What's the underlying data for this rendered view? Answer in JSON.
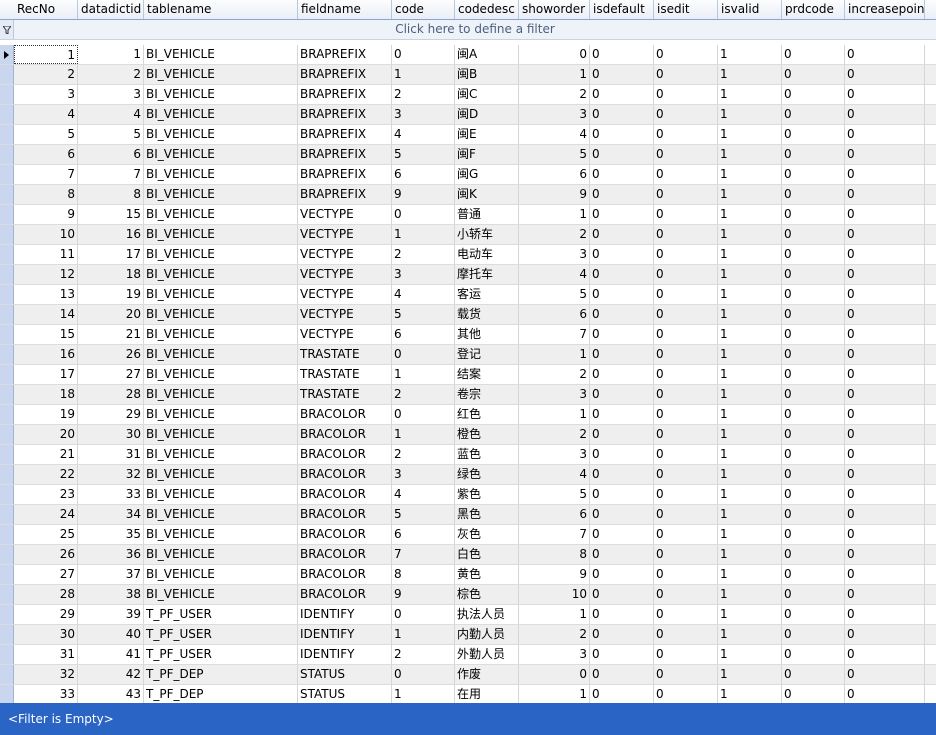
{
  "columns": [
    "RecNo",
    "datadictid",
    "tablename",
    "fieldname",
    "code",
    "codedesc",
    "showorder",
    "isdefault",
    "isedit",
    "isvalid",
    "prdcode",
    "increasepoint"
  ],
  "filter_prompt": "Click here to define a filter",
  "status_text": "<Filter is Empty>",
  "rows": [
    [
      "1",
      "1",
      "BI_VEHICLE",
      "BRAPREFIX",
      "0",
      "闽A",
      "0",
      "0",
      "0",
      "1",
      "0",
      "0"
    ],
    [
      "2",
      "2",
      "BI_VEHICLE",
      "BRAPREFIX",
      "1",
      "闽B",
      "1",
      "0",
      "0",
      "1",
      "0",
      "0"
    ],
    [
      "3",
      "3",
      "BI_VEHICLE",
      "BRAPREFIX",
      "2",
      "闽C",
      "2",
      "0",
      "0",
      "1",
      "0",
      "0"
    ],
    [
      "4",
      "4",
      "BI_VEHICLE",
      "BRAPREFIX",
      "3",
      "闽D",
      "3",
      "0",
      "0",
      "1",
      "0",
      "0"
    ],
    [
      "5",
      "5",
      "BI_VEHICLE",
      "BRAPREFIX",
      "4",
      "闽E",
      "4",
      "0",
      "0",
      "1",
      "0",
      "0"
    ],
    [
      "6",
      "6",
      "BI_VEHICLE",
      "BRAPREFIX",
      "5",
      "闽F",
      "5",
      "0",
      "0",
      "1",
      "0",
      "0"
    ],
    [
      "7",
      "7",
      "BI_VEHICLE",
      "BRAPREFIX",
      "6",
      "闽G",
      "6",
      "0",
      "0",
      "1",
      "0",
      "0"
    ],
    [
      "8",
      "8",
      "BI_VEHICLE",
      "BRAPREFIX",
      "9",
      "闽K",
      "9",
      "0",
      "0",
      "1",
      "0",
      "0"
    ],
    [
      "9",
      "15",
      "BI_VEHICLE",
      "VECTYPE",
      "0",
      "普通",
      "1",
      "0",
      "0",
      "1",
      "0",
      "0"
    ],
    [
      "10",
      "16",
      "BI_VEHICLE",
      "VECTYPE",
      "1",
      "小轿车",
      "2",
      "0",
      "0",
      "1",
      "0",
      "0"
    ],
    [
      "11",
      "17",
      "BI_VEHICLE",
      "VECTYPE",
      "2",
      "电动车",
      "3",
      "0",
      "0",
      "1",
      "0",
      "0"
    ],
    [
      "12",
      "18",
      "BI_VEHICLE",
      "VECTYPE",
      "3",
      "摩托车",
      "4",
      "0",
      "0",
      "1",
      "0",
      "0"
    ],
    [
      "13",
      "19",
      "BI_VEHICLE",
      "VECTYPE",
      "4",
      "客运",
      "5",
      "0",
      "0",
      "1",
      "0",
      "0"
    ],
    [
      "14",
      "20",
      "BI_VEHICLE",
      "VECTYPE",
      "5",
      "载货",
      "6",
      "0",
      "0",
      "1",
      "0",
      "0"
    ],
    [
      "15",
      "21",
      "BI_VEHICLE",
      "VECTYPE",
      "6",
      "其他",
      "7",
      "0",
      "0",
      "1",
      "0",
      "0"
    ],
    [
      "16",
      "26",
      "BI_VEHICLE",
      "TRASTATE",
      "0",
      "登记",
      "1",
      "0",
      "0",
      "1",
      "0",
      "0"
    ],
    [
      "17",
      "27",
      "BI_VEHICLE",
      "TRASTATE",
      "1",
      "结案",
      "2",
      "0",
      "0",
      "1",
      "0",
      "0"
    ],
    [
      "18",
      "28",
      "BI_VEHICLE",
      "TRASTATE",
      "2",
      "卷宗",
      "3",
      "0",
      "0",
      "1",
      "0",
      "0"
    ],
    [
      "19",
      "29",
      "BI_VEHICLE",
      "BRACOLOR",
      "0",
      "红色",
      "1",
      "0",
      "0",
      "1",
      "0",
      "0"
    ],
    [
      "20",
      "30",
      "BI_VEHICLE",
      "BRACOLOR",
      "1",
      "橙色",
      "2",
      "0",
      "0",
      "1",
      "0",
      "0"
    ],
    [
      "21",
      "31",
      "BI_VEHICLE",
      "BRACOLOR",
      "2",
      "蓝色",
      "3",
      "0",
      "0",
      "1",
      "0",
      "0"
    ],
    [
      "22",
      "32",
      "BI_VEHICLE",
      "BRACOLOR",
      "3",
      "绿色",
      "4",
      "0",
      "0",
      "1",
      "0",
      "0"
    ],
    [
      "23",
      "33",
      "BI_VEHICLE",
      "BRACOLOR",
      "4",
      "紫色",
      "5",
      "0",
      "0",
      "1",
      "0",
      "0"
    ],
    [
      "24",
      "34",
      "BI_VEHICLE",
      "BRACOLOR",
      "5",
      "黑色",
      "6",
      "0",
      "0",
      "1",
      "0",
      "0"
    ],
    [
      "25",
      "35",
      "BI_VEHICLE",
      "BRACOLOR",
      "6",
      "灰色",
      "7",
      "0",
      "0",
      "1",
      "0",
      "0"
    ],
    [
      "26",
      "36",
      "BI_VEHICLE",
      "BRACOLOR",
      "7",
      "白色",
      "8",
      "0",
      "0",
      "1",
      "0",
      "0"
    ],
    [
      "27",
      "37",
      "BI_VEHICLE",
      "BRACOLOR",
      "8",
      "黄色",
      "9",
      "0",
      "0",
      "1",
      "0",
      "0"
    ],
    [
      "28",
      "38",
      "BI_VEHICLE",
      "BRACOLOR",
      "9",
      "棕色",
      "10",
      "0",
      "0",
      "1",
      "0",
      "0"
    ],
    [
      "29",
      "39",
      "T_PF_USER",
      "IDENTIFY",
      "0",
      "执法人员",
      "1",
      "0",
      "0",
      "1",
      "0",
      "0"
    ],
    [
      "30",
      "40",
      "T_PF_USER",
      "IDENTIFY",
      "1",
      "内勤人员",
      "2",
      "0",
      "0",
      "1",
      "0",
      "0"
    ],
    [
      "31",
      "41",
      "T_PF_USER",
      "IDENTIFY",
      "2",
      "外勤人员",
      "3",
      "0",
      "0",
      "1",
      "0",
      "0"
    ],
    [
      "32",
      "42",
      "T_PF_DEP",
      "STATUS",
      "0",
      "作废",
      "0",
      "0",
      "0",
      "1",
      "0",
      "0"
    ],
    [
      "33",
      "43",
      "T_PF_DEP",
      "STATUS",
      "1",
      "在用",
      "1",
      "0",
      "0",
      "1",
      "0",
      "0"
    ]
  ],
  "icons": {
    "row_indicator": "current-row-arrow-icon",
    "filter": "filter-funnel-icon"
  },
  "colors": {
    "status_bar": "#2a64c5",
    "alt_row": "#efefef",
    "indicator": "#c9d6ee"
  }
}
